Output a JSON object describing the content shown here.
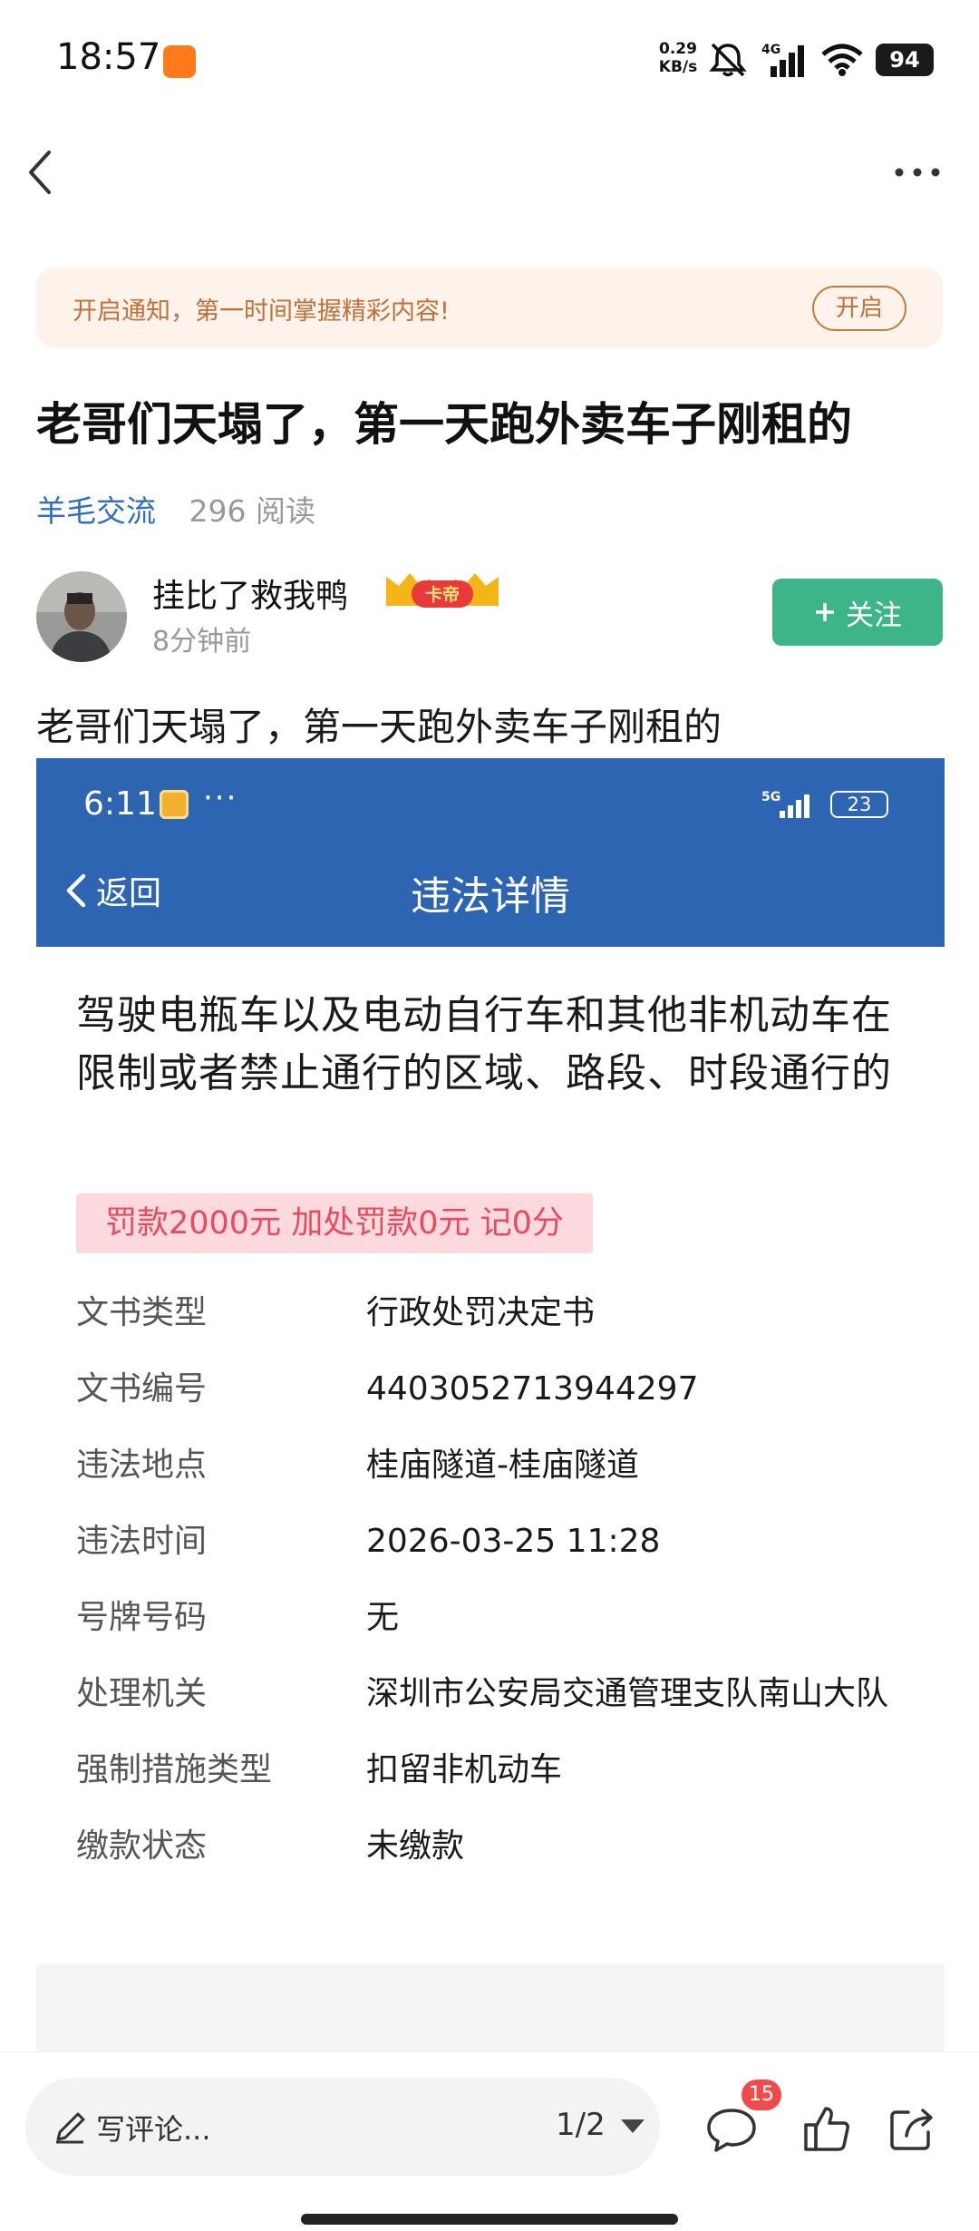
{
  "status_bar": {
    "time": "18:57",
    "net_speed_value": "0.29",
    "net_speed_unit": "KB/s",
    "network": "4G",
    "battery": "94",
    "icons": [
      "app-notification-icon",
      "mute-icon",
      "signal-icon",
      "wifi-icon",
      "battery-icon"
    ]
  },
  "nav": {
    "icons": [
      "back-icon",
      "more-icon"
    ]
  },
  "notify": {
    "text": "开启通知，第一时间掌握精彩内容!",
    "button": "开启"
  },
  "post": {
    "title": "老哥们天塌了，第一天跑外卖车子刚租的",
    "topic": "羊毛交流",
    "reads": "296 阅读",
    "body": "老哥们天塌了，第一天跑外卖车子刚租的"
  },
  "author": {
    "name": "挂比了救我鸭",
    "badge": "卡帝",
    "time": "8分钟前",
    "follow_label": "关注"
  },
  "screenshot": {
    "status_time": "6:11",
    "status_dots": "···",
    "network": "5G",
    "battery": "23",
    "back_label": "返回",
    "title": "违法详情",
    "violation": "驾驶电瓶车以及电动自行车和其他非机动车在限制或者禁止通行的区域、路段、时段通行的",
    "fine": "罚款2000元 加处罚款0元 记0分",
    "details": [
      {
        "label": "文书类型",
        "value": "行政处罚决定书"
      },
      {
        "label": "文书编号",
        "value": "4403052713944297"
      },
      {
        "label": "违法地点",
        "value": "桂庙隧道-桂庙隧道"
      },
      {
        "label": "违法时间",
        "value": "2026-03-25 11:28"
      },
      {
        "label": "号牌号码",
        "value": "无"
      },
      {
        "label": "处理机关",
        "value": "深圳市公安局交通管理支队南山大队"
      },
      {
        "label": "强制措施类型",
        "value": "扣留非机动车"
      },
      {
        "label": "缴款状态",
        "value": "未缴款"
      }
    ]
  },
  "bottom": {
    "placeholder": "写评论...",
    "page": "1/2",
    "comment_count": "15"
  },
  "colors": {
    "accent_green": "#3db589",
    "topic_blue": "#2f6fbd",
    "header_blue": "#2e65b3",
    "fine_red": "#e84a5f",
    "notify_bg": "#fdf3ea",
    "badge_red": "#f04b4b"
  }
}
